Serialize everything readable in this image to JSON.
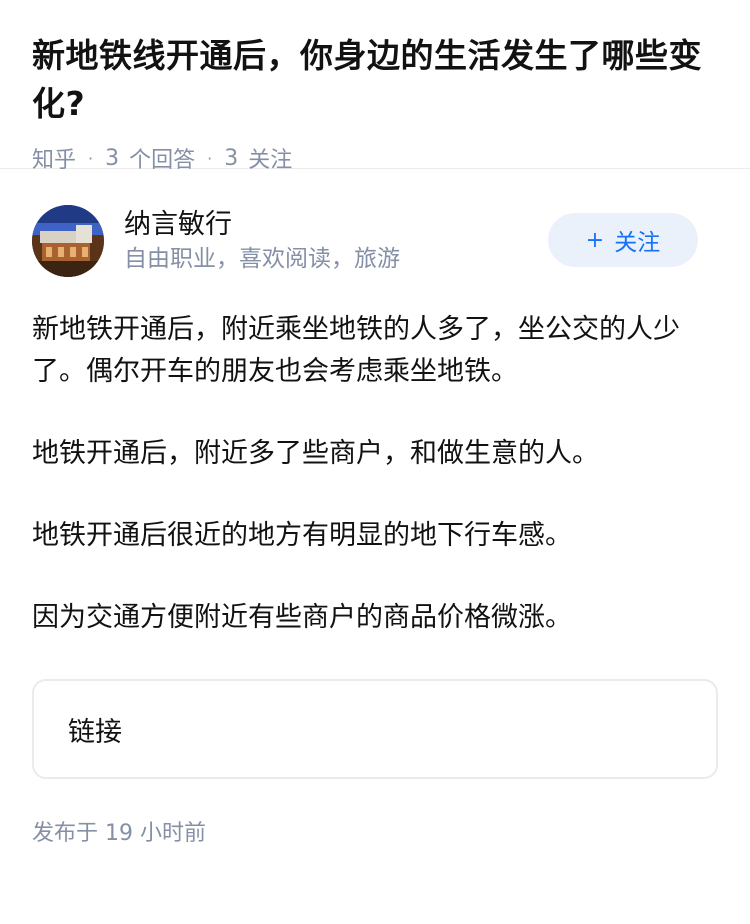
{
  "question": {
    "title": "新地铁线开通后，你身边的生活发生了哪些变化?",
    "source": "知乎",
    "answer_count": "3",
    "answer_label": "个回答",
    "follow_count": "3",
    "follow_label": "关注"
  },
  "answer": {
    "author": {
      "name": "纳言敏行",
      "bio": "自由职业，喜欢阅读，旅游"
    },
    "follow_button": {
      "icon": "plus-icon",
      "label": "关注"
    },
    "paragraphs": [
      "新地铁开通后，附近乘坐地铁的人多了，坐公交的人少了。偶尔开车的朋友也会考虑乘坐地铁。",
      "地铁开通后，附近多了些商户，和做生意的人。",
      "地铁开通后很近的地方有明显的地下行车感。",
      "因为交通方便附近有些商户的商品价格微涨。"
    ],
    "link_card_label": "链接",
    "publish_time": "发布于 19 小时前"
  },
  "colors": {
    "accent": "#1772f6",
    "follow_bg": "#eaf1fb",
    "meta_text": "#8590a6",
    "border": "#ebebeb"
  }
}
